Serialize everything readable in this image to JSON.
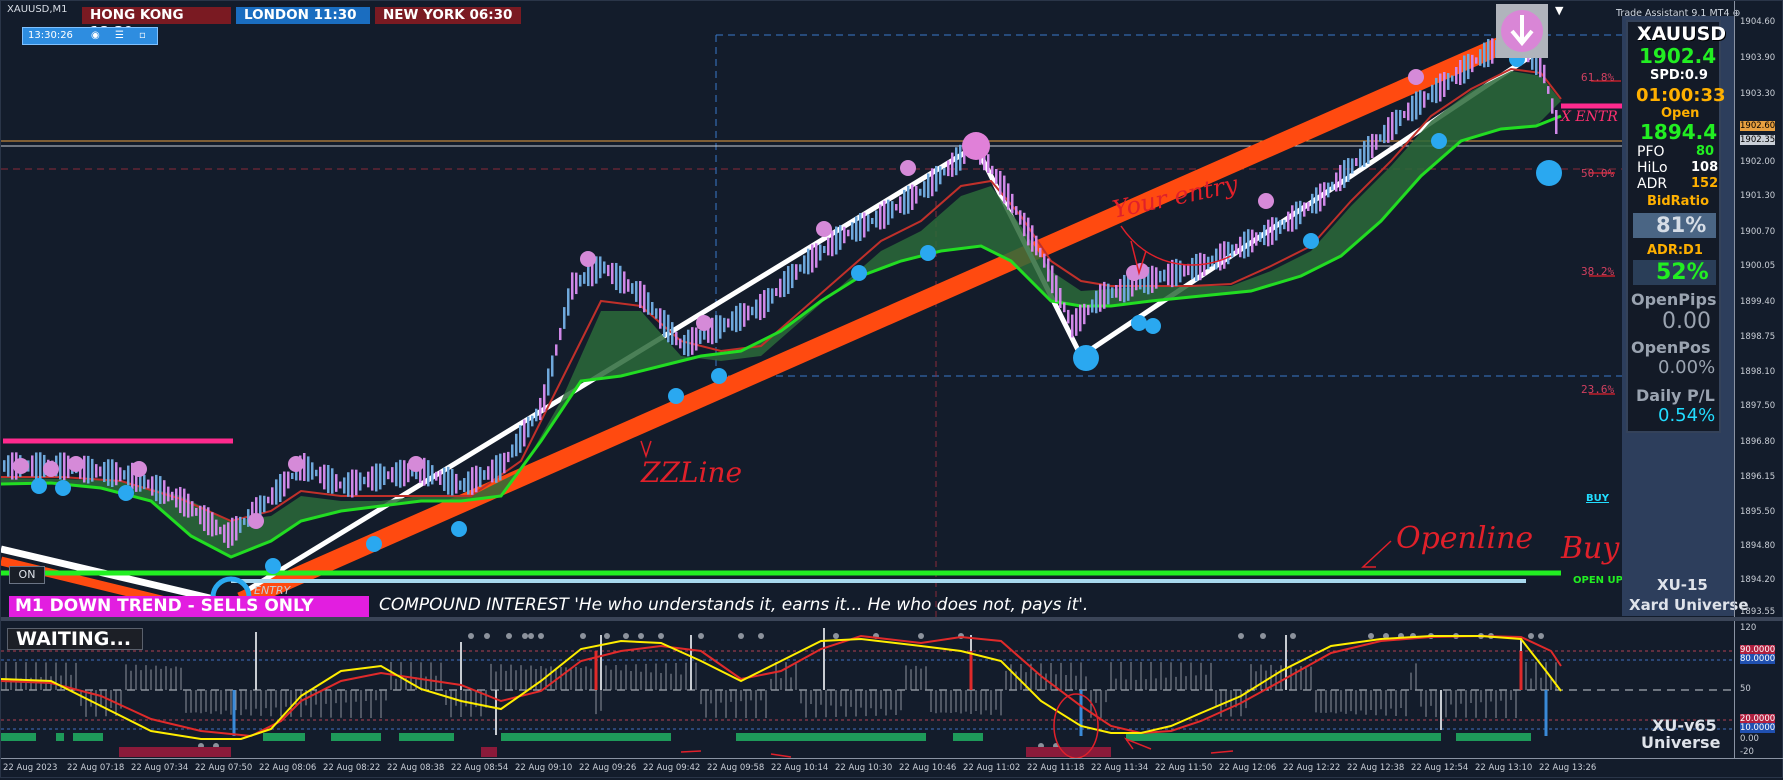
{
  "symbol_title": "XAUUSD,M1",
  "sessions": [
    {
      "label": "HONG KONG 18:30",
      "color": "#7a1a22"
    },
    {
      "label": "LONDON  11:30",
      "color": "#1a6dc0"
    },
    {
      "label": "NEW YORK  06:30",
      "color": "#7a1a22"
    }
  ],
  "clock": "13:30:26",
  "trade_assistant": "Trade Assistant 9.1 MT4",
  "panel": {
    "symbol": "XAUUSD",
    "bid": "1902.4",
    "spread": "SPD:0.9",
    "timer": "01:00:33",
    "open_label": "Open",
    "open_value": "1894.4",
    "pfo_label": "PFO",
    "pfo_value": "80",
    "hilo_label": "HiLo",
    "hilo_value": "108",
    "adr_label": "ADR",
    "adr_value": "152",
    "bidratio_label": "BidRatio",
    "bidratio_value": "81%",
    "adr_d1_label": "ADR:D1",
    "adr_d1_value": "52%",
    "openpips_label": "OpenPips",
    "openpips_value": "0.00",
    "openpos_label": "OpenPos",
    "openpos_value": "0.00%",
    "dailypl_label": "Daily P/L",
    "dailypl_value": "0.54%",
    "brand_top": "XU-15",
    "brand_bottom": "Xard Universe"
  },
  "price_axis": [
    "1904.60",
    "1903.90",
    "1903.30",
    "1902.60",
    "1902.35",
    "1902.00",
    "1901.30",
    "1900.70",
    "1900.05",
    "1899.40",
    "1898.75",
    "1898.10",
    "1897.50",
    "1896.80",
    "1896.15",
    "1895.50",
    "1894.80",
    "1894.20",
    "1893.55"
  ],
  "fib_levels": [
    "61.8%",
    "50.0%",
    "38.2%",
    "23.6%"
  ],
  "labels": {
    "on_button": "ON",
    "trend_banner": "M1  DOWN TREND - SELLS ONLY",
    "quote": "COMPOUND INTEREST  'He who understands it, earns it... He who does not, pays it'.",
    "entry_small": "ENTRY",
    "buy_small": "BUY",
    "open_up": "OPEN UP",
    "x_entry": "X ENTR",
    "waiting": "WAITING...",
    "ind_brand_top": "XU-v65",
    "ind_brand_bottom": "Universe"
  },
  "annotations": {
    "zzline": "ZZLine",
    "your_entry": "Your entry",
    "openline": "Openline",
    "buy": "Buy"
  },
  "indicator_axis": [
    "120",
    "90.0000",
    "80.0000",
    "50",
    "20.0000",
    "10.0000",
    "0.00",
    "-20"
  ],
  "time_axis": [
    "22 Aug 2023",
    "22 Aug 07:18",
    "22 Aug 07:34",
    "22 Aug 07:50",
    "22 Aug 08:06",
    "22 Aug 08:22",
    "22 Aug 08:38",
    "22 Aug 08:54",
    "22 Aug 09:10",
    "22 Aug 09:26",
    "22 Aug 09:42",
    "22 Aug 09:58",
    "22 Aug 10:14",
    "22 Aug 10:30",
    "22 Aug 10:46",
    "22 Aug 11:02",
    "22 Aug 11:18",
    "22 Aug 11:34",
    "22 Aug 11:50",
    "22 Aug 12:06",
    "22 Aug 12:22",
    "22 Aug 12:38",
    "22 Aug 12:54",
    "22 Aug 13:10",
    "22 Aug 13:26"
  ],
  "colors": {
    "bg": "#131c2b",
    "zz_orange": "#ff4a10",
    "trend_white": "#ffffff",
    "fast_ma": "#22dd22",
    "slow_ma_fill": "#2c6a3a",
    "down_candle": "#d088e8",
    "up_candle": "#6fa8dc",
    "pink_dot": "#d58ad8",
    "blue_dot": "#2aa8f0",
    "open_line": "#22ee22",
    "magenta_line": "#ff2a8e"
  }
}
